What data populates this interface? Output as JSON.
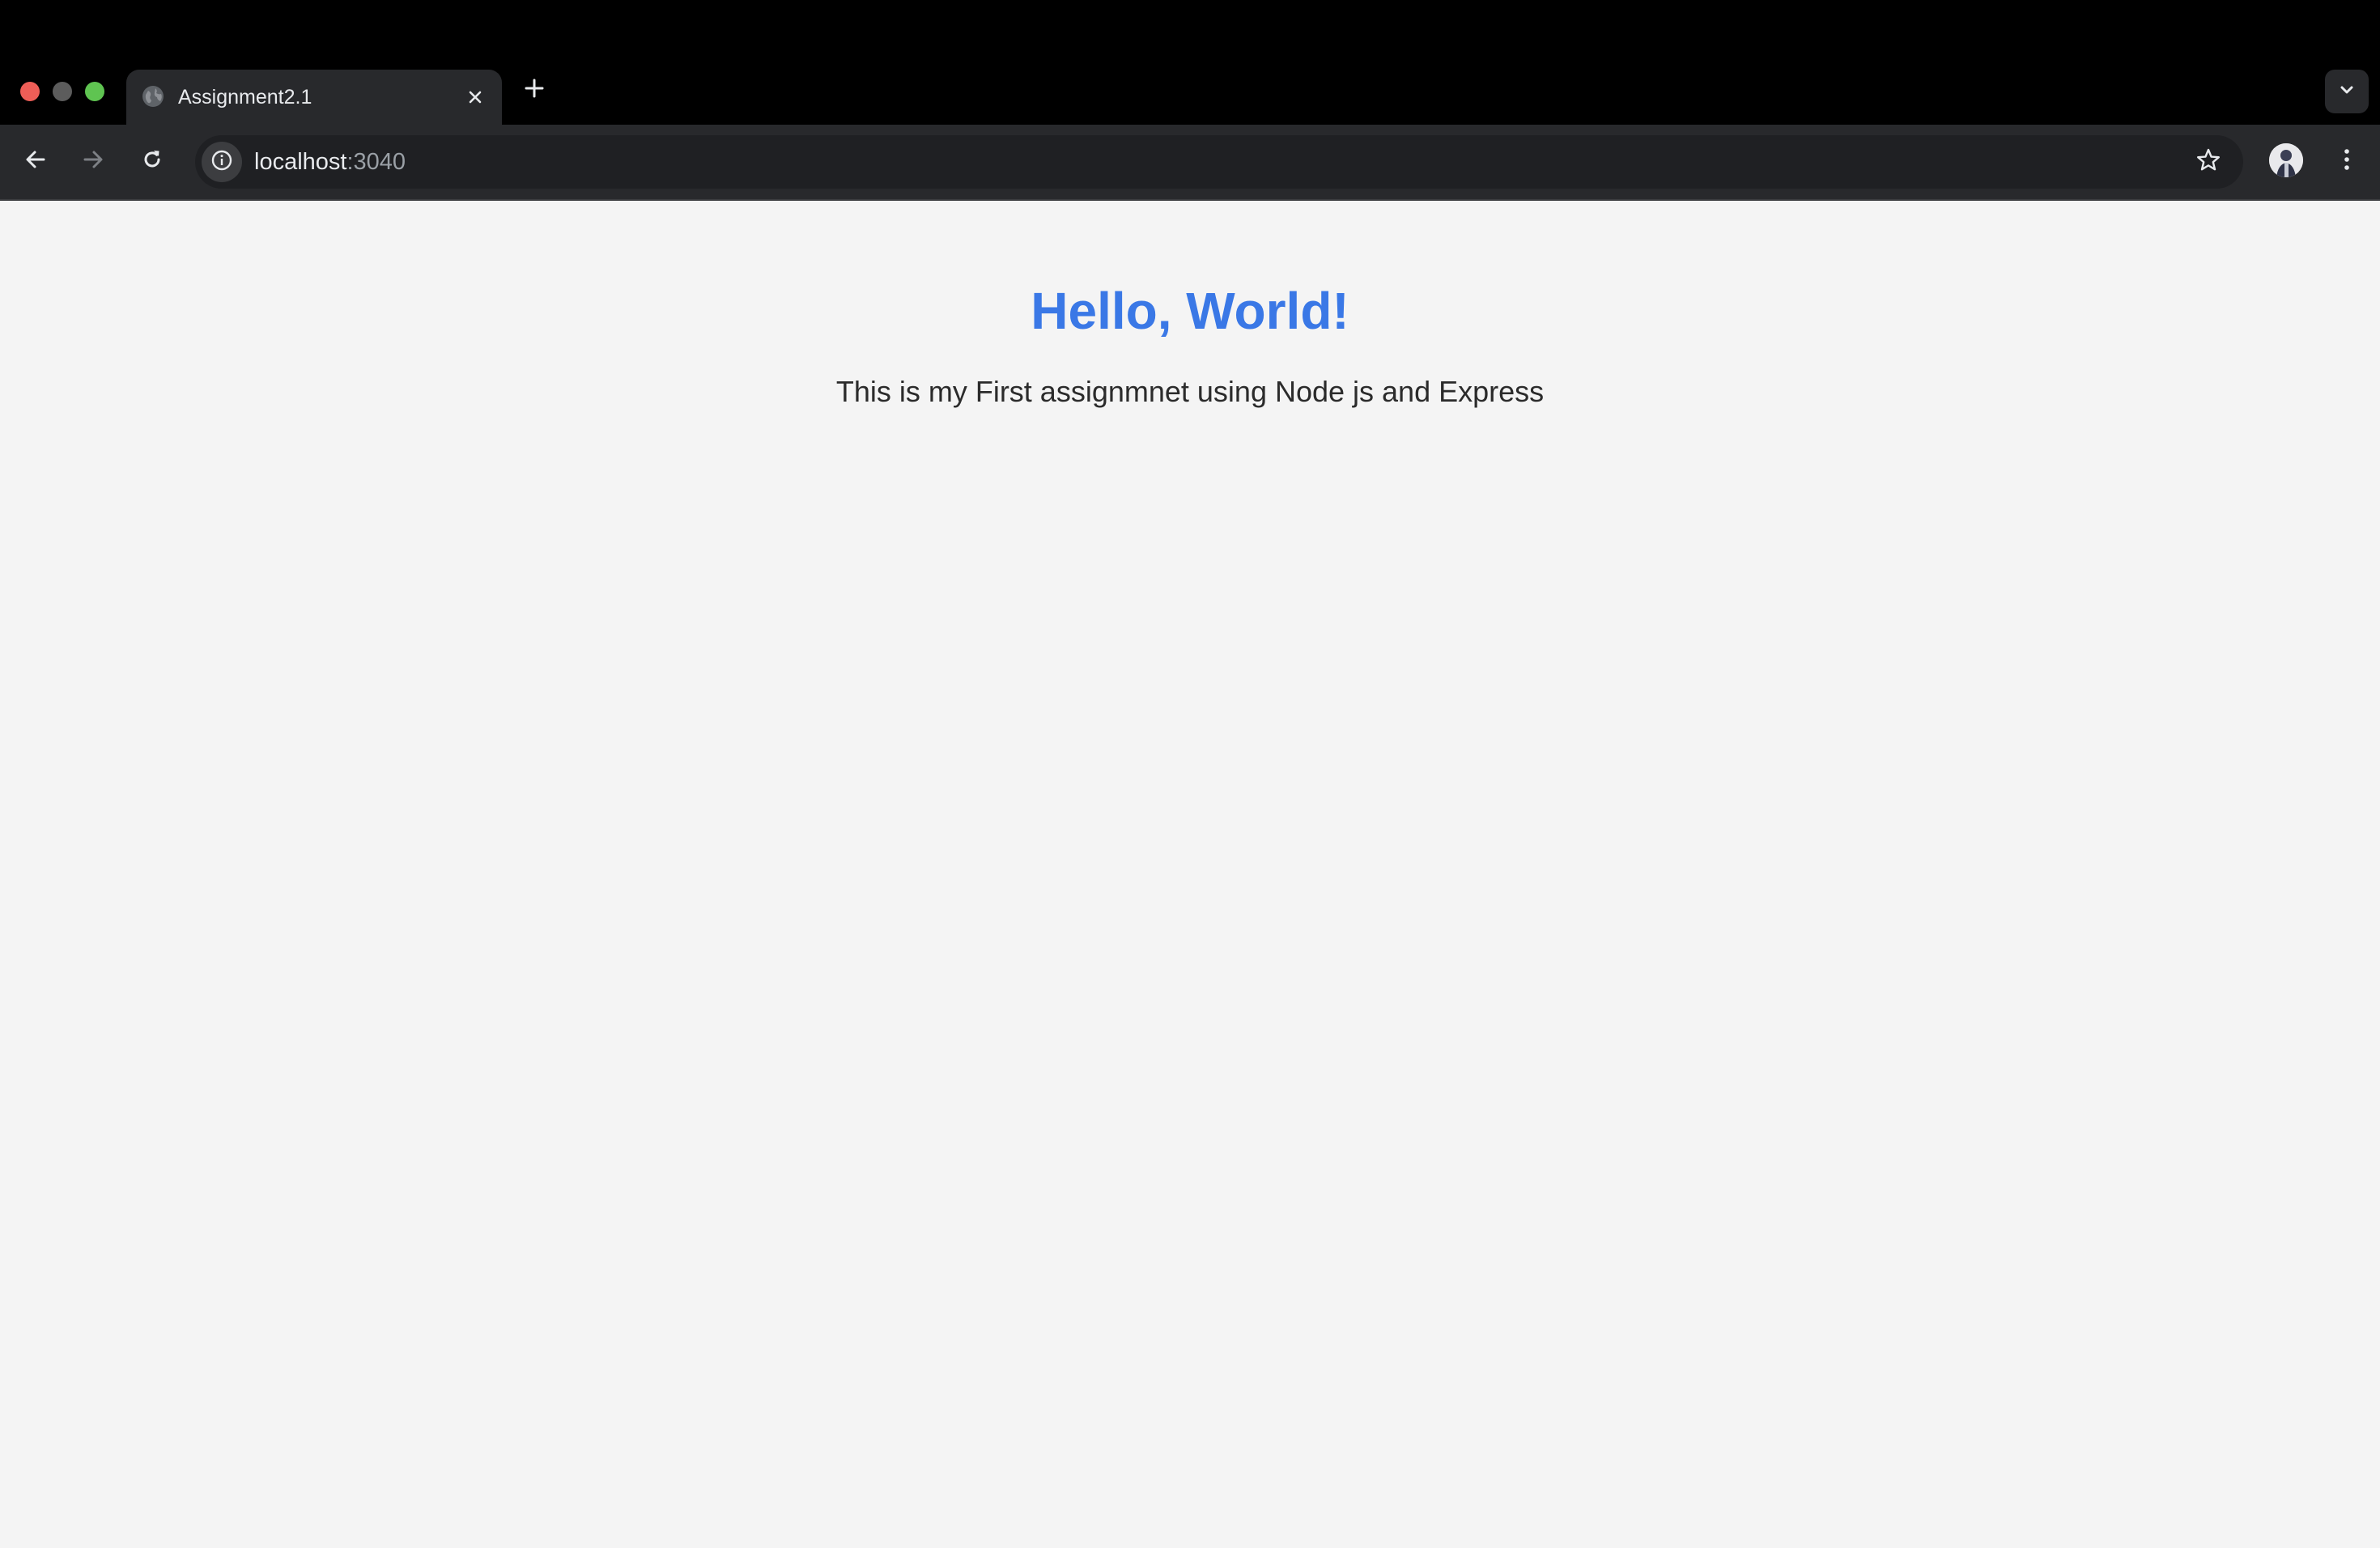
{
  "browser": {
    "tab": {
      "title": "Assignment2.1",
      "favicon": "globe-icon"
    },
    "address_bar": {
      "host": "localhost",
      "port": ":3040"
    },
    "icons": {
      "back": "arrow-left-icon",
      "forward": "arrow-right-icon",
      "reload": "reload-icon",
      "site_info": "info-icon",
      "bookmark": "star-icon",
      "menu": "kebab-menu-icon",
      "new_tab": "plus-icon",
      "tab_search": "chevron-down-icon",
      "tab_close": "close-icon"
    },
    "colors": {
      "close_light": "#ee5e57",
      "minimize_light": "#5c5c5c",
      "maximize_light": "#5fc451"
    }
  },
  "page": {
    "heading": "Hello, World!",
    "text": "This is my First assignmnet using Node js and Express",
    "colors": {
      "heading": "#3a78e6",
      "background": "#f4f4f4"
    }
  }
}
